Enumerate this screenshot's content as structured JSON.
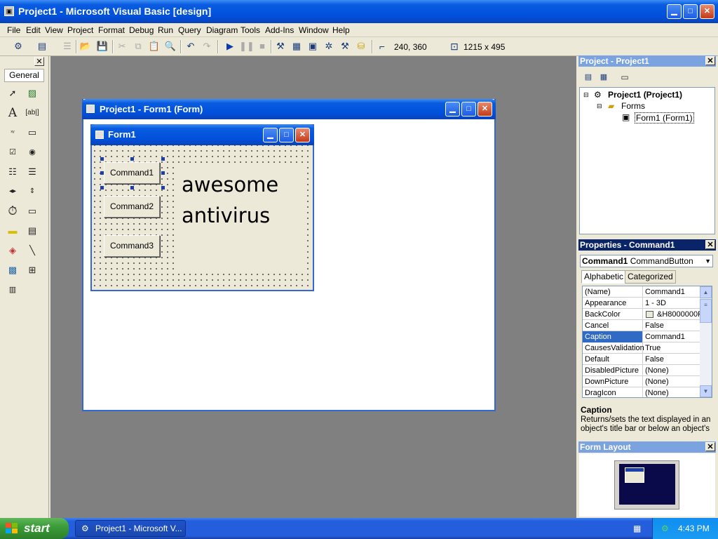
{
  "window": {
    "title": "Project1 - Microsoft Visual Basic [design]"
  },
  "menu": [
    "File",
    "Edit",
    "View",
    "Project",
    "Format",
    "Debug",
    "Run",
    "Query",
    "Diagram",
    "Tools",
    "Add-Ins",
    "Window",
    "Help"
  ],
  "toolbar": {
    "position": "240, 360",
    "size": "1215 x 495"
  },
  "toolbox": {
    "tab_label": "General"
  },
  "form_window": {
    "title": "Project1 - Form1 (Form)"
  },
  "form": {
    "title": "Form1",
    "buttons": [
      "Command1",
      "Command2",
      "Command3"
    ],
    "label_text": [
      "awesome",
      "antivirus"
    ]
  },
  "project_panel": {
    "title": "Project - Project1",
    "tree": {
      "root": "Project1 (Project1)",
      "folder": "Forms",
      "item": "Form1 (Form1)"
    }
  },
  "properties_panel": {
    "title": "Properties - Command1",
    "object_name": "Command1",
    "object_type": "CommandButton",
    "tabs": [
      "Alphabetic",
      "Categorized"
    ],
    "rows": [
      {
        "name": "(Name)",
        "value": "Command1"
      },
      {
        "name": "Appearance",
        "value": "1 - 3D"
      },
      {
        "name": "BackColor",
        "value": "&H8000000F"
      },
      {
        "name": "Cancel",
        "value": "False"
      },
      {
        "name": "Caption",
        "value": "Command1"
      },
      {
        "name": "CausesValidation",
        "value": "True"
      },
      {
        "name": "Default",
        "value": "False"
      },
      {
        "name": "DisabledPicture",
        "value": "(None)"
      },
      {
        "name": "DownPicture",
        "value": "(None)"
      },
      {
        "name": "DragIcon",
        "value": "(None)"
      }
    ],
    "selected_row": "Caption",
    "description_title": "Caption",
    "description_text": "Returns/sets the text displayed in an object's title bar or below an object's"
  },
  "layout_panel": {
    "title": "Form Layout"
  },
  "taskbar": {
    "start_label": "start",
    "task_label": "Project1 - Microsoft V...",
    "clock": "4:43 PM"
  }
}
